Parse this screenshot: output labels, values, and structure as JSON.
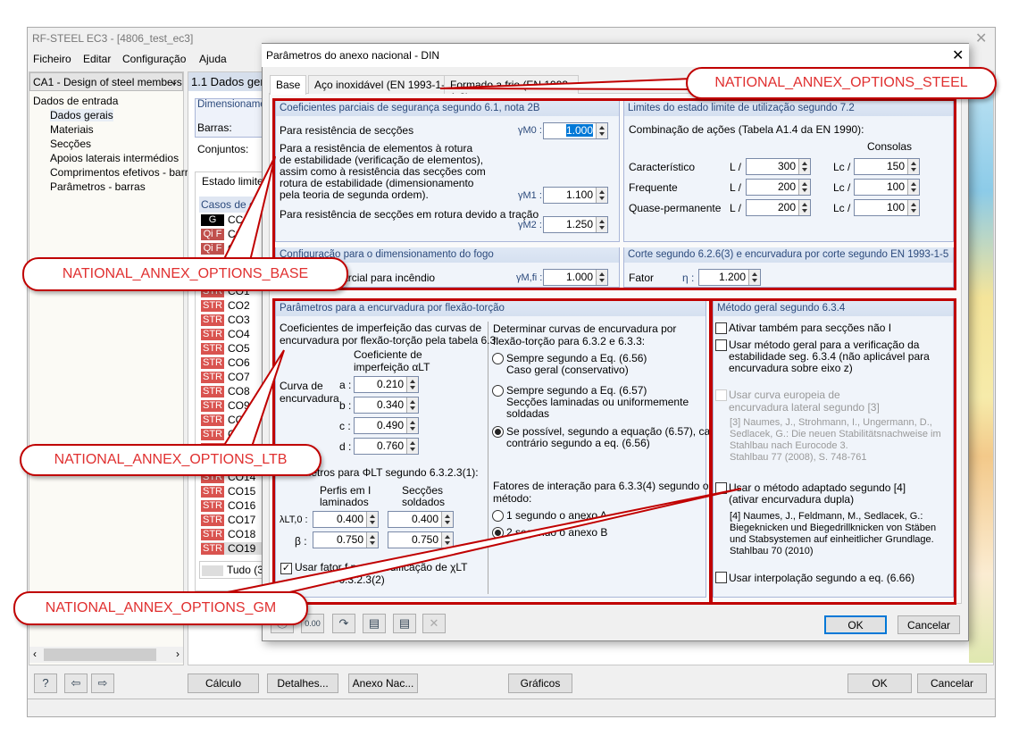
{
  "app": {
    "title": "RF-STEEL EC3 - [4806_test_ec3]",
    "menu": [
      "Ficheiro",
      "Editar",
      "Configuração",
      "Ajuda"
    ],
    "case_select": "CA1 - Design of steel members",
    "tree": {
      "root": "Dados de entrada",
      "items": [
        "Dados gerais",
        "Materiais",
        "Secções",
        "Apoios laterais intermédios",
        "Comprimentos efetivos - barras",
        "Parâmetros - barras"
      ]
    },
    "panel_title": "1.1 Dados gerais",
    "dim_group": "Dimensionamento",
    "barras_label": "Barras:",
    "conjuntos_label": "Conjuntos:",
    "tab_uls": "Estado limite último",
    "casos_header": "Casos de carga",
    "load_cases": [
      {
        "tag": "G",
        "color": "#000000",
        "name": "CC1"
      },
      {
        "tag": "Qi F",
        "color": "#c0504d",
        "name": "CO"
      },
      {
        "tag": "Qi F",
        "color": "#c0504d",
        "name": "C"
      }
    ],
    "str_cases": [
      "CO1",
      "CO2",
      "CO3",
      "CO4",
      "CO5",
      "CO6",
      "CO7",
      "CO8",
      "CO9",
      "CO10",
      "CO11",
      "CO12",
      "CO13",
      "CO14",
      "CO15",
      "CO16",
      "CO17",
      "CO18",
      "CO19"
    ],
    "all_label": "Tudo (3",
    "buttons": {
      "calc": "Cálculo",
      "details": "Detalhes...",
      "annex": "Anexo Nac...",
      "graphics": "Gráficos",
      "ok": "OK",
      "cancel": "Cancelar"
    }
  },
  "dialog": {
    "title": "Parâmetros do anexo nacional - DIN",
    "tabs": [
      "Base",
      "Aço inoxidável (EN 1993-1-4)",
      "Formado a frio (EN 1993-1-3)"
    ],
    "partial": {
      "header": "Coeficientes parciais de segurança segundo 6.1, nota 2B",
      "m0_text": "Para resistência de secções",
      "m0_sym": "γM0 :",
      "m0": "1.000",
      "m1_text": [
        "Para a resistência de elementos à rotura",
        "de estabilidade (verificação de elementos),",
        "assim como à resistência das secções com",
        "rotura de estabilidade (dimensionamento",
        "pela teoria de segunda ordem)."
      ],
      "m1_sym": "γM1 :",
      "m1": "1.100",
      "m2_text": "Para resistência de secções em rotura devido a tração",
      "m2_sym": "γM2 :",
      "m2": "1.250"
    },
    "sls": {
      "header": "Limites do estado limite de utilização segundo 7.2",
      "combo": "Combinação de ações (Tabela A1.4 da EN 1990):",
      "consolas": "Consolas",
      "l": "L /",
      "lc": "Lc /",
      "rows": [
        {
          "label": "Característico",
          "l": "300",
          "lc": "150"
        },
        {
          "label": "Frequente",
          "l": "200",
          "lc": "100"
        },
        {
          "label": "Quase-permanente",
          "l": "200",
          "lc": "100"
        }
      ]
    },
    "fire": {
      "header": "Configuração para o dimensionamento do fogo",
      "text": "Coeficiente parcial para incêndio",
      "sym": "γM,fi :",
      "value": "1.000"
    },
    "shear": {
      "header": "Corte segundo 6.2.6(3) e encurvadura por corte segundo EN 1993-1-5",
      "label": "Fator",
      "sym": "η :",
      "value": "1.200"
    },
    "ltb": {
      "header": "Parâmetros para a encurvadura por flexão-torção",
      "intro": [
        "Coeficientes de imperfeição das curvas de",
        "encurvadura por flexão-torção pela tabela 6.3:"
      ],
      "coef_head": [
        "Coeficiente de",
        "imperfeição αLT"
      ],
      "curve_label": [
        "Curva de",
        "encurvadura"
      ],
      "curves": [
        {
          "k": "a :",
          "v": "0.210"
        },
        {
          "k": "b :",
          "v": "0.340"
        },
        {
          "k": "c :",
          "v": "0.490"
        },
        {
          "k": "d :",
          "v": "0.760"
        }
      ],
      "phi_head": "Parâmetros para ΦLT segundo 6.3.2.3(1):",
      "col1": [
        "Perfis em I",
        "laminados"
      ],
      "col2": [
        "Secções",
        "soldados"
      ],
      "lambda_sym": "λLT,0 :",
      "lambda": [
        "0.400",
        "0.400"
      ],
      "beta_sym": "β :",
      "beta": [
        "0.750",
        "0.750"
      ],
      "f_check": {
        "checked": true,
        "lines": [
          "Usar fator f para modificação de χLT",
          "segundo 6.3.2.3(2)"
        ]
      },
      "det_head": [
        "Determinar curvas de encurvadura por",
        "flexão-torção para 6.3.2 e 6.3.3:"
      ],
      "det_opts": [
        {
          "lines": [
            "Sempre segundo a Eq. (6.56)",
            "Caso geral (conservativo)"
          ],
          "on": false
        },
        {
          "lines": [
            "Sempre segundo a Eq. (6.57)",
            "Secções laminadas ou uniformemente",
            "soldadas"
          ],
          "on": false
        },
        {
          "lines": [
            "Se possível, segundo a equação (6.57), caso",
            "contrário segundo a eq. (6.56)"
          ],
          "on": true
        }
      ],
      "int_head": [
        "Fatores de interação para 6.3.3(4) segundo o",
        "método:"
      ],
      "int_opts": [
        {
          "label": "1 segundo o anexo A",
          "on": false
        },
        {
          "label": "2 segundo o anexo B",
          "on": true
        }
      ]
    },
    "gm": {
      "header": "Método geral segundo 6.3.4",
      "c1": "Ativar também para secções não I",
      "c2": [
        "Usar método geral para a verificação da",
        "estabilidade seg. 6.3.4 (não aplicável para",
        "encurvadura sobre eixo z)"
      ],
      "c3": [
        "Usar curva europeia de",
        "encurvadura lateral segundo [3]"
      ],
      "ref3": [
        "[3] Naumes, J., Strohmann, I., Ungermann, D.,",
        "Sedlacek, G.: Die neuen Stabilitätsnachweise im",
        "Stahlbau nach Eurocode 3.",
        "Stahlbau 77 (2008), S. 748-761"
      ],
      "c4": [
        "Usar o método adaptado segundo [4]",
        "(ativar encurvadura dupla)"
      ],
      "ref4": [
        "[4] Naumes, J., Feldmann, M., Sedlacek, G.:",
        "Biegeknicken und Biegedrillknicken von Stäben",
        "und Stabsystemen auf einheitlicher Grundlage.",
        "Stahlbau 70 (2010)"
      ],
      "c5": "Usar interpolação segundo a eq. (6.66)"
    },
    "ok": "OK",
    "cancel": "Cancelar"
  },
  "callouts": {
    "steel": "NATIONAL_ANNEX_OPTIONS_STEEL",
    "base": "NATIONAL_ANNEX_OPTIONS_BASE",
    "ltb": "NATIONAL_ANNEX_OPTIONS_LTB",
    "gm": "NATIONAL_ANNEX_OPTIONS_GM",
    "color": "#c00000"
  }
}
